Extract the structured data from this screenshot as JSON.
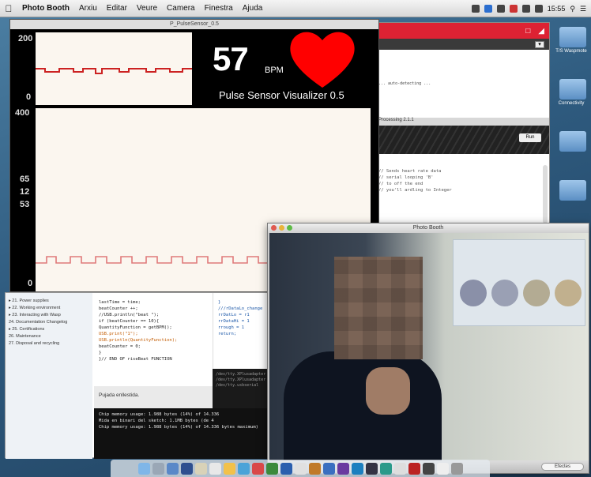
{
  "menubar": {
    "app_name": "Photo Booth",
    "menus": [
      "Arxiu",
      "Editar",
      "Veure",
      "Camera",
      "Finestra",
      "Ajuda"
    ],
    "clock": "15:55"
  },
  "visualizer": {
    "window_title": "P_PulseSensor_0.5",
    "bpm_value": "57",
    "bpm_unit": "BPM",
    "title": "Pulse Sensor Visualizer 0.5",
    "top_scale": [
      "200",
      "0"
    ],
    "main_scale": [
      "400",
      "65",
      "12",
      "53",
      "0"
    ],
    "heart_color": "#ff0000",
    "trace_color": "#cc2222"
  },
  "processing_window": {
    "version": "Processing 2.1.1",
    "button_label": "Run",
    "dropdown_icon": "chevron-down-icon",
    "log_text": "... auto-detecting ...",
    "console_lines": [
      "// Sends heart rate data",
      "// serial looping 'B'",
      "// to off the end",
      "// you'll ardling to Integer"
    ]
  },
  "editor_window": {
    "toc_items": [
      "▸ 21. Power supplies",
      "▸ 22. Working environment",
      "▸ 23. Interacting with Wasp",
      "  24. Documentation Changelog",
      "▸ 25. Certifications",
      "  26. Maintenance",
      "  27. Disposal and recycling"
    ],
    "code_lines": [
      "  lastTime = time;",
      "  beatCounter ++;",
      "  //USB.println(\"beat \");",
      "  if (beatCounter == 10){",
      "    QuantityFunction = getBPM();",
      "    USB.print(\"1\");",
      "    USB.println(QuantityFunction);",
      "    beatCounter = 0;",
      "  }",
      "}// END OF riseBeat FUNCTION"
    ],
    "code2_lines": [
      "}",
      "///rDataLo_change",
      "  rrDatLo = r1",
      "  rrDataHi = 1",
      "  rrough = 1",
      "  return;"
    ],
    "status": "Pujada enllestida.",
    "console_lines": [
      "Chip memory usage: 1.988 bytes (14%) of 14.336",
      "Mida en binari del sketch: 1.1MB bytes (de 4",
      "Chip memory usage: 1.988 bytes (14%) of 14.336 bytes maximum)"
    ],
    "console2_lines": [
      "/dev/tty.XPlusadapter",
      "/dev/tty.XPlusadapter",
      "/dev/tty.usbserial"
    ]
  },
  "photo_booth": {
    "window_title": "Photo Booth",
    "bottom_button": "Efectes"
  },
  "desktop_icon_labels": [
    "T/S Waspmote",
    "Connectivity"
  ]
}
